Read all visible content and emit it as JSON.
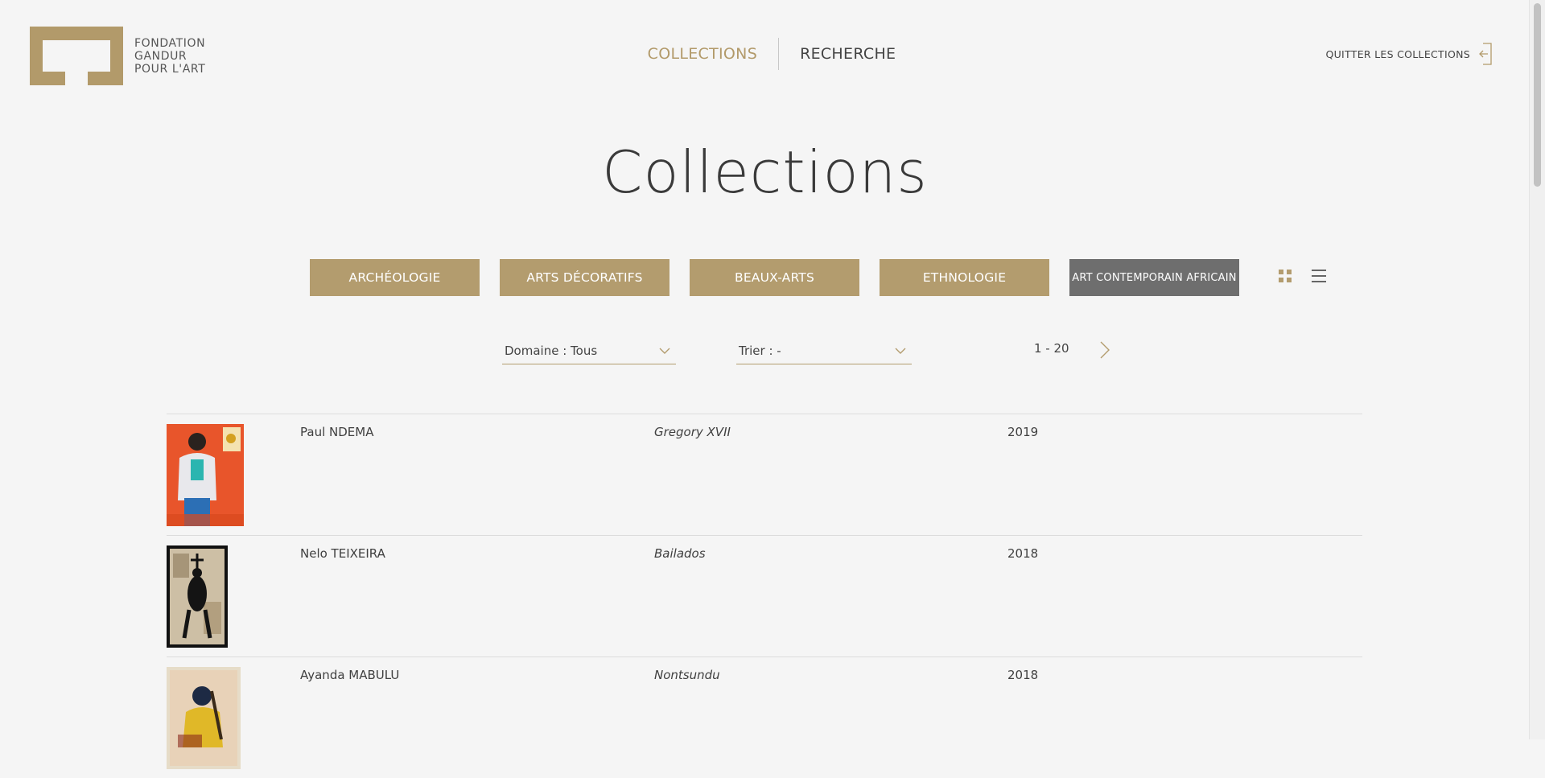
{
  "brand": {
    "lines": [
      "FONDATION",
      "GANDUR",
      "POUR L'ART"
    ],
    "color": "#b29a6a"
  },
  "nav": {
    "collections": "COLLECTIONS",
    "recherche": "RECHERCHE",
    "quit": "QUITTER LES COLLECTIONS"
  },
  "page_title": "Collections",
  "categories": [
    {
      "label": "ARCHÉOLOGIE",
      "active": false
    },
    {
      "label": "ARTS DÉCORATIFS",
      "active": false
    },
    {
      "label": "BEAUX-ARTS",
      "active": false
    },
    {
      "label": "ETHNOLOGIE",
      "active": false
    },
    {
      "label": "ART CONTEMPORAIN AFRICAIN",
      "active": true
    }
  ],
  "view_modes": [
    "grid-icon",
    "list-icon"
  ],
  "filters": {
    "domaine": "Domaine : Tous",
    "trier": "Trier :  -"
  },
  "pagination": {
    "range": "1 - 20"
  },
  "artworks": [
    {
      "artist": "Paul NDEMA",
      "title": "Gregory XVII",
      "year": "2019"
    },
    {
      "artist": "Nelo TEIXEIRA",
      "title": "Bailados",
      "year": "2018"
    },
    {
      "artist": "Ayanda MABULU",
      "title": "Nontsundu",
      "year": "2018"
    }
  ],
  "colors": {
    "accent": "#b39c6e",
    "active_category": "#6e6e6e",
    "background": "#f5f5f5"
  }
}
